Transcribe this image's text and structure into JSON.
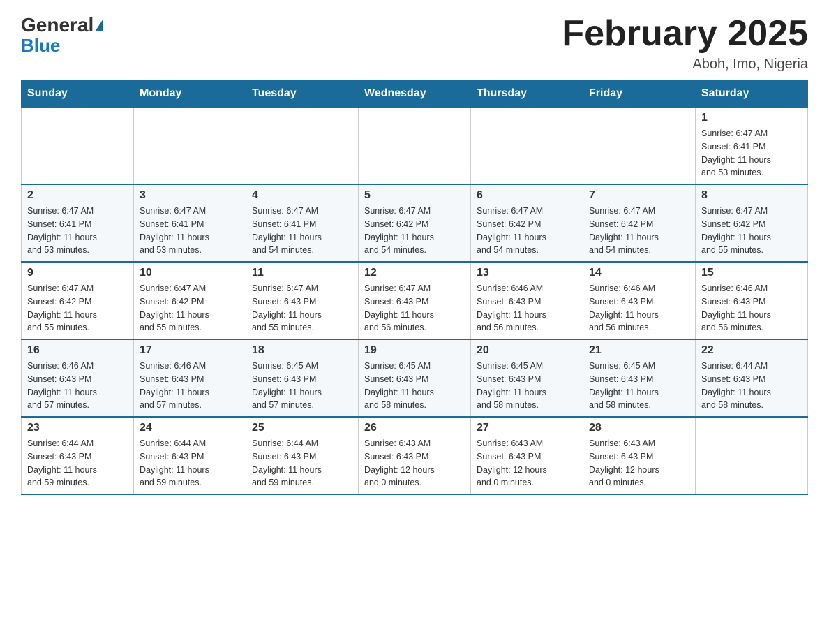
{
  "header": {
    "logo": {
      "general": "General",
      "blue": "Blue"
    },
    "title": "February 2025",
    "location": "Aboh, Imo, Nigeria"
  },
  "weekdays": [
    "Sunday",
    "Monday",
    "Tuesday",
    "Wednesday",
    "Thursday",
    "Friday",
    "Saturday"
  ],
  "weeks": [
    [
      {
        "day": "",
        "info": ""
      },
      {
        "day": "",
        "info": ""
      },
      {
        "day": "",
        "info": ""
      },
      {
        "day": "",
        "info": ""
      },
      {
        "day": "",
        "info": ""
      },
      {
        "day": "",
        "info": ""
      },
      {
        "day": "1",
        "info": "Sunrise: 6:47 AM\nSunset: 6:41 PM\nDaylight: 11 hours\nand 53 minutes."
      }
    ],
    [
      {
        "day": "2",
        "info": "Sunrise: 6:47 AM\nSunset: 6:41 PM\nDaylight: 11 hours\nand 53 minutes."
      },
      {
        "day": "3",
        "info": "Sunrise: 6:47 AM\nSunset: 6:41 PM\nDaylight: 11 hours\nand 53 minutes."
      },
      {
        "day": "4",
        "info": "Sunrise: 6:47 AM\nSunset: 6:41 PM\nDaylight: 11 hours\nand 54 minutes."
      },
      {
        "day": "5",
        "info": "Sunrise: 6:47 AM\nSunset: 6:42 PM\nDaylight: 11 hours\nand 54 minutes."
      },
      {
        "day": "6",
        "info": "Sunrise: 6:47 AM\nSunset: 6:42 PM\nDaylight: 11 hours\nand 54 minutes."
      },
      {
        "day": "7",
        "info": "Sunrise: 6:47 AM\nSunset: 6:42 PM\nDaylight: 11 hours\nand 54 minutes."
      },
      {
        "day": "8",
        "info": "Sunrise: 6:47 AM\nSunset: 6:42 PM\nDaylight: 11 hours\nand 55 minutes."
      }
    ],
    [
      {
        "day": "9",
        "info": "Sunrise: 6:47 AM\nSunset: 6:42 PM\nDaylight: 11 hours\nand 55 minutes."
      },
      {
        "day": "10",
        "info": "Sunrise: 6:47 AM\nSunset: 6:42 PM\nDaylight: 11 hours\nand 55 minutes."
      },
      {
        "day": "11",
        "info": "Sunrise: 6:47 AM\nSunset: 6:43 PM\nDaylight: 11 hours\nand 55 minutes."
      },
      {
        "day": "12",
        "info": "Sunrise: 6:47 AM\nSunset: 6:43 PM\nDaylight: 11 hours\nand 56 minutes."
      },
      {
        "day": "13",
        "info": "Sunrise: 6:46 AM\nSunset: 6:43 PM\nDaylight: 11 hours\nand 56 minutes."
      },
      {
        "day": "14",
        "info": "Sunrise: 6:46 AM\nSunset: 6:43 PM\nDaylight: 11 hours\nand 56 minutes."
      },
      {
        "day": "15",
        "info": "Sunrise: 6:46 AM\nSunset: 6:43 PM\nDaylight: 11 hours\nand 56 minutes."
      }
    ],
    [
      {
        "day": "16",
        "info": "Sunrise: 6:46 AM\nSunset: 6:43 PM\nDaylight: 11 hours\nand 57 minutes."
      },
      {
        "day": "17",
        "info": "Sunrise: 6:46 AM\nSunset: 6:43 PM\nDaylight: 11 hours\nand 57 minutes."
      },
      {
        "day": "18",
        "info": "Sunrise: 6:45 AM\nSunset: 6:43 PM\nDaylight: 11 hours\nand 57 minutes."
      },
      {
        "day": "19",
        "info": "Sunrise: 6:45 AM\nSunset: 6:43 PM\nDaylight: 11 hours\nand 58 minutes."
      },
      {
        "day": "20",
        "info": "Sunrise: 6:45 AM\nSunset: 6:43 PM\nDaylight: 11 hours\nand 58 minutes."
      },
      {
        "day": "21",
        "info": "Sunrise: 6:45 AM\nSunset: 6:43 PM\nDaylight: 11 hours\nand 58 minutes."
      },
      {
        "day": "22",
        "info": "Sunrise: 6:44 AM\nSunset: 6:43 PM\nDaylight: 11 hours\nand 58 minutes."
      }
    ],
    [
      {
        "day": "23",
        "info": "Sunrise: 6:44 AM\nSunset: 6:43 PM\nDaylight: 11 hours\nand 59 minutes."
      },
      {
        "day": "24",
        "info": "Sunrise: 6:44 AM\nSunset: 6:43 PM\nDaylight: 11 hours\nand 59 minutes."
      },
      {
        "day": "25",
        "info": "Sunrise: 6:44 AM\nSunset: 6:43 PM\nDaylight: 11 hours\nand 59 minutes."
      },
      {
        "day": "26",
        "info": "Sunrise: 6:43 AM\nSunset: 6:43 PM\nDaylight: 12 hours\nand 0 minutes."
      },
      {
        "day": "27",
        "info": "Sunrise: 6:43 AM\nSunset: 6:43 PM\nDaylight: 12 hours\nand 0 minutes."
      },
      {
        "day": "28",
        "info": "Sunrise: 6:43 AM\nSunset: 6:43 PM\nDaylight: 12 hours\nand 0 minutes."
      },
      {
        "day": "",
        "info": ""
      }
    ]
  ]
}
